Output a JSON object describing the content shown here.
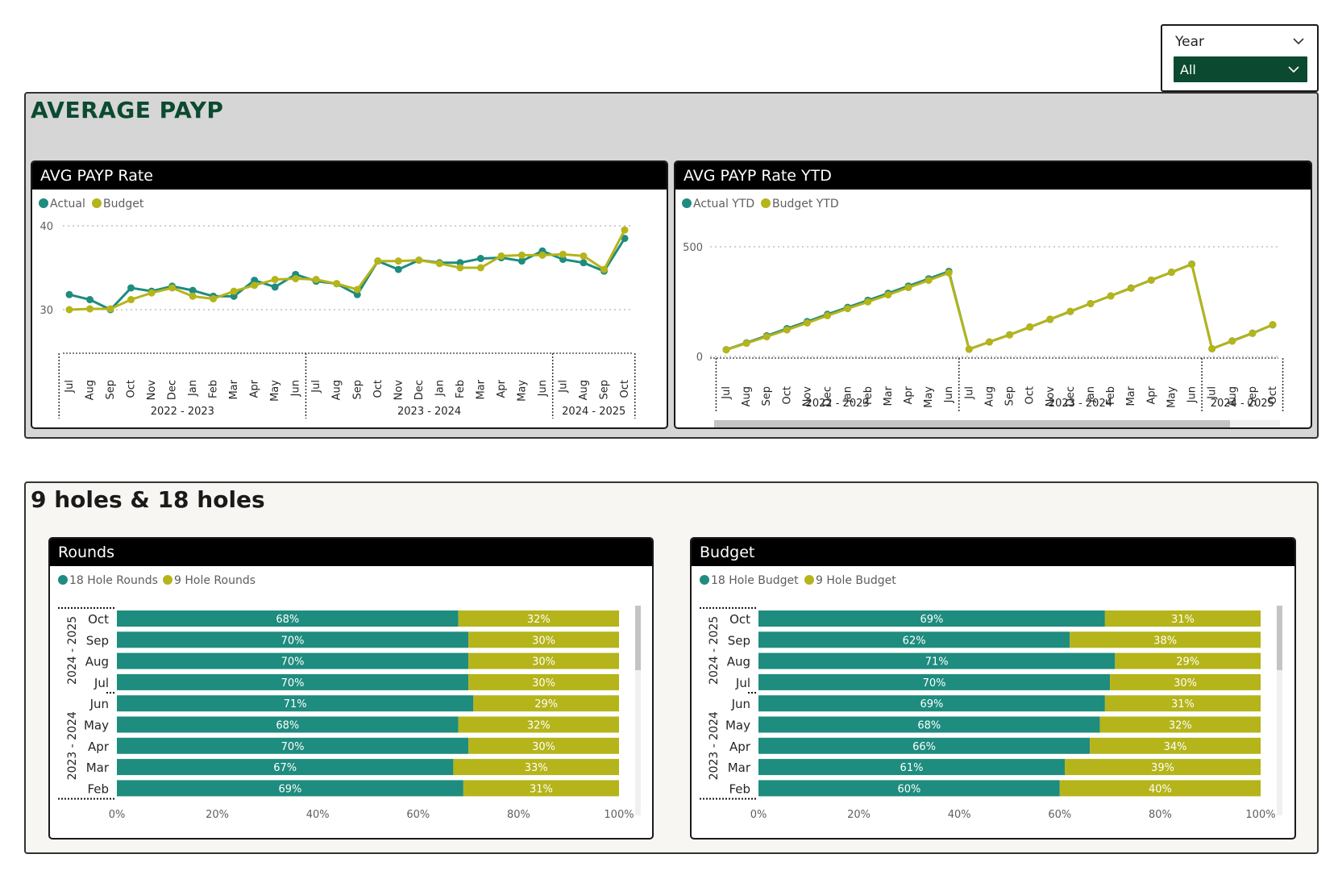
{
  "slicer": {
    "title": "Year",
    "value": "All"
  },
  "colors": {
    "actual": "#1e8c7e",
    "budget": "#b5b41a",
    "brand": "#0b4a30"
  },
  "sections": {
    "payp_title": "AVERAGE PAYP",
    "holes_title": "9 holes & 18 holes"
  },
  "cards": {
    "payp_rate": "AVG PAYP Rate",
    "payp_ytd": "AVG PAYP Rate YTD",
    "rounds": "Rounds",
    "budget": "Budget"
  },
  "chart_data": [
    {
      "type": "line",
      "title": "AVG PAYP Rate",
      "x": [
        "Jul",
        "Aug",
        "Sep",
        "Oct",
        "Nov",
        "Dec",
        "Jan",
        "Feb",
        "Mar",
        "Apr",
        "May",
        "Jun",
        "Jul",
        "Aug",
        "Sep",
        "Oct",
        "Nov",
        "Dec",
        "Jan",
        "Feb",
        "Mar",
        "Apr",
        "May",
        "Jun",
        "Jul",
        "Aug",
        "Sep",
        "Oct"
      ],
      "groups": [
        {
          "label": "2022 - 2023",
          "count": 12
        },
        {
          "label": "2023 - 2024",
          "count": 12
        },
        {
          "label": "2024 - 2025",
          "count": 4
        }
      ],
      "series": [
        {
          "name": "Actual",
          "values": [
            31.8,
            31.2,
            30.0,
            32.6,
            32.2,
            32.8,
            32.3,
            31.6,
            31.6,
            33.5,
            32.7,
            34.2,
            33.4,
            33.1,
            31.8,
            35.8,
            34.8,
            35.9,
            35.6,
            35.6,
            36.1,
            36.2,
            35.8,
            37.0,
            36.0,
            35.6,
            34.6,
            38.5
          ]
        },
        {
          "name": "Budget",
          "values": [
            30.0,
            30.1,
            30.1,
            31.2,
            32.0,
            32.6,
            31.6,
            31.3,
            32.2,
            32.9,
            33.6,
            33.7,
            33.6,
            33.1,
            32.4,
            35.8,
            35.8,
            35.9,
            35.5,
            35.0,
            35.0,
            36.4,
            36.5,
            36.5,
            36.6,
            36.4,
            34.8,
            39.5
          ]
        }
      ],
      "yticks": [
        30,
        40
      ],
      "ylim": [
        25,
        40
      ],
      "legend": "top-left",
      "grid": true
    },
    {
      "type": "line",
      "title": "AVG PAYP Rate YTD",
      "x": [
        "Jul",
        "Aug",
        "Sep",
        "Oct",
        "Nov",
        "Dec",
        "Jan",
        "Feb",
        "Mar",
        "Apr",
        "May",
        "Jun",
        "Jul",
        "Aug",
        "Sep",
        "Oct",
        "Nov",
        "Dec",
        "Jan",
        "Feb",
        "Mar",
        "Apr",
        "May",
        "Jun",
        "Jul",
        "Aug",
        "Sep",
        "Oct"
      ],
      "groups": [
        {
          "label": "2022 - 2023",
          "count": 12
        },
        {
          "label": "2023 - 2024",
          "count": 12
        },
        {
          "label": "2024 - 2025",
          "count": 4
        }
      ],
      "series": [
        {
          "name": "Actual YTD",
          "values": [
            31,
            62,
            94,
            127,
            159,
            192,
            224,
            256,
            288,
            321,
            354,
            388,
            33,
            66,
            99,
            134,
            169,
            205,
            241,
            276,
            312,
            348,
            384,
            421,
            35,
            71,
            106,
            144
          ]
        },
        {
          "name": "Budget YTD",
          "values": [
            30,
            60,
            90,
            121,
            153,
            186,
            218,
            249,
            281,
            314,
            347,
            381,
            33,
            66,
            98,
            134,
            170,
            206,
            241,
            276,
            311,
            348,
            384,
            420,
            35,
            70,
            105,
            145
          ]
        }
      ],
      "yticks": [
        0,
        500
      ],
      "ylim": [
        0,
        500
      ],
      "legend": "top-left",
      "grid": true
    },
    {
      "type": "bar",
      "stacked": "100%",
      "title": "Rounds",
      "categories": [
        "Oct",
        "Sep",
        "Aug",
        "Jul",
        "Jun",
        "May",
        "Apr",
        "Mar",
        "Feb"
      ],
      "groups": [
        {
          "label": "2024 - 2025",
          "count": 4
        },
        {
          "label": "2023 - 2024",
          "count": 5
        }
      ],
      "series": [
        {
          "name": "18 Hole Rounds",
          "values": [
            68,
            70,
            70,
            70,
            71,
            68,
            70,
            67,
            69
          ]
        },
        {
          "name": "9 Hole Rounds",
          "values": [
            32,
            30,
            30,
            30,
            29,
            32,
            30,
            33,
            31
          ]
        }
      ],
      "xticks": [
        "0%",
        "20%",
        "40%",
        "60%",
        "80%",
        "100%"
      ],
      "legend": "top-left"
    },
    {
      "type": "bar",
      "stacked": "100%",
      "title": "Budget",
      "categories": [
        "Oct",
        "Sep",
        "Aug",
        "Jul",
        "Jun",
        "May",
        "Apr",
        "Mar",
        "Feb"
      ],
      "groups": [
        {
          "label": "2024 - 2025",
          "count": 4
        },
        {
          "label": "2023 - 2024",
          "count": 5
        }
      ],
      "series": [
        {
          "name": "18 Hole Budget",
          "values": [
            69,
            62,
            71,
            70,
            69,
            68,
            66,
            61,
            60
          ]
        },
        {
          "name": "9 Hole Budget",
          "values": [
            31,
            38,
            29,
            30,
            31,
            32,
            34,
            39,
            40
          ]
        }
      ],
      "xticks": [
        "0%",
        "20%",
        "40%",
        "60%",
        "80%",
        "100%"
      ],
      "legend": "top-left"
    }
  ]
}
